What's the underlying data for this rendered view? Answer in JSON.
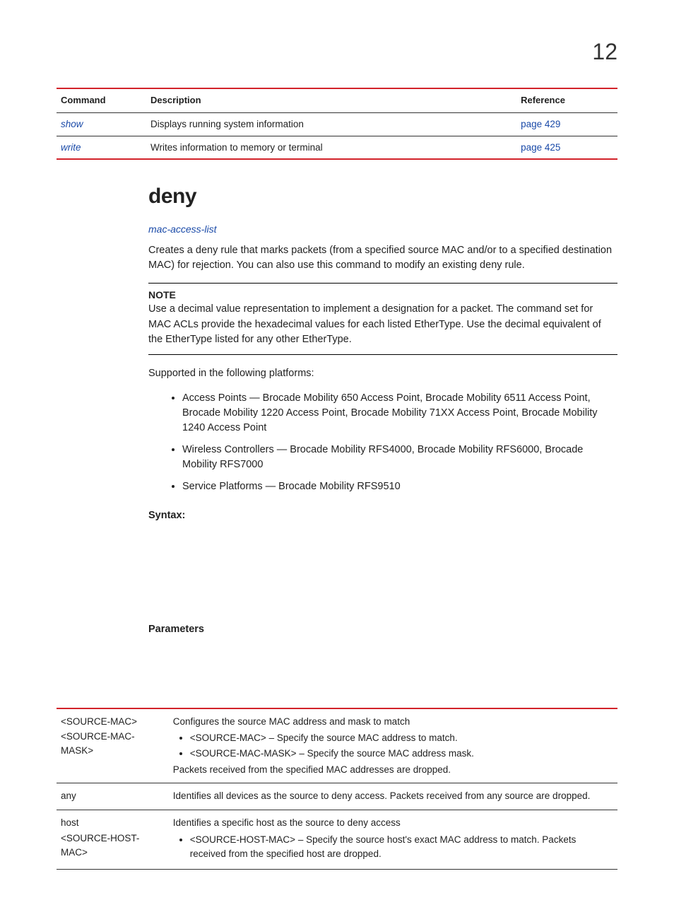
{
  "page_number": "12",
  "cmd_table": {
    "headers": {
      "command": "Command",
      "description": "Description",
      "reference": "Reference"
    },
    "rows": [
      {
        "command": "show",
        "description": "Displays running system information",
        "reference": "page 429"
      },
      {
        "command": "write",
        "description": "Writes information to memory or terminal",
        "reference": "page 425"
      }
    ]
  },
  "section": {
    "title": "deny",
    "sublink": "mac-access-list",
    "intro": "Creates a deny rule that marks packets (from a specified source MAC and/or to a specified destination MAC) for rejection. You can also use this command to modify an existing deny rule.",
    "note_label": "NOTE",
    "note_body": "Use a decimal value representation to implement a                             designation for a packet. The command set for MAC ACLs provide the hexadecimal values for each listed EtherType. Use the decimal equivalent of the EtherType listed for any other EtherType.",
    "supported_intro": "Supported in the following platforms:",
    "supported": [
      "Access Points — Brocade Mobility 650 Access Point, Brocade Mobility 6511 Access Point, Brocade Mobility 1220 Access Point, Brocade Mobility 71XX Access Point, Brocade Mobility 1240 Access Point",
      "Wireless Controllers — Brocade Mobility RFS4000, Brocade Mobility RFS6000, Brocade Mobility RFS7000",
      "Service Platforms — Brocade Mobility RFS9510"
    ],
    "syntax_label": "Syntax:",
    "parameters_label": "Parameters"
  },
  "param_table": [
    {
      "keys": [
        "<SOURCE-MAC>",
        "<SOURCE-MAC-MASK>"
      ],
      "desc_intro": "Configures the source MAC address and mask to match",
      "bullets": [
        "<SOURCE-MAC> – Specify the source MAC address to match.",
        "<SOURCE-MAC-MASK> – Specify the source MAC address mask."
      ],
      "desc_after": "Packets received from the specified MAC addresses are dropped."
    },
    {
      "keys": [
        "any"
      ],
      "desc_intro": "Identifies all devices as the source to deny access. Packets received from any source are dropped.",
      "bullets": [],
      "desc_after": ""
    },
    {
      "keys": [
        "host",
        "<SOURCE-HOST-MAC>"
      ],
      "desc_intro": "Identifies a specific host as the source to deny access",
      "bullets": [
        "<SOURCE-HOST-MAC> – Specify the source host's exact MAC address to match. Packets received from the specified host are dropped."
      ],
      "desc_after": ""
    }
  ]
}
